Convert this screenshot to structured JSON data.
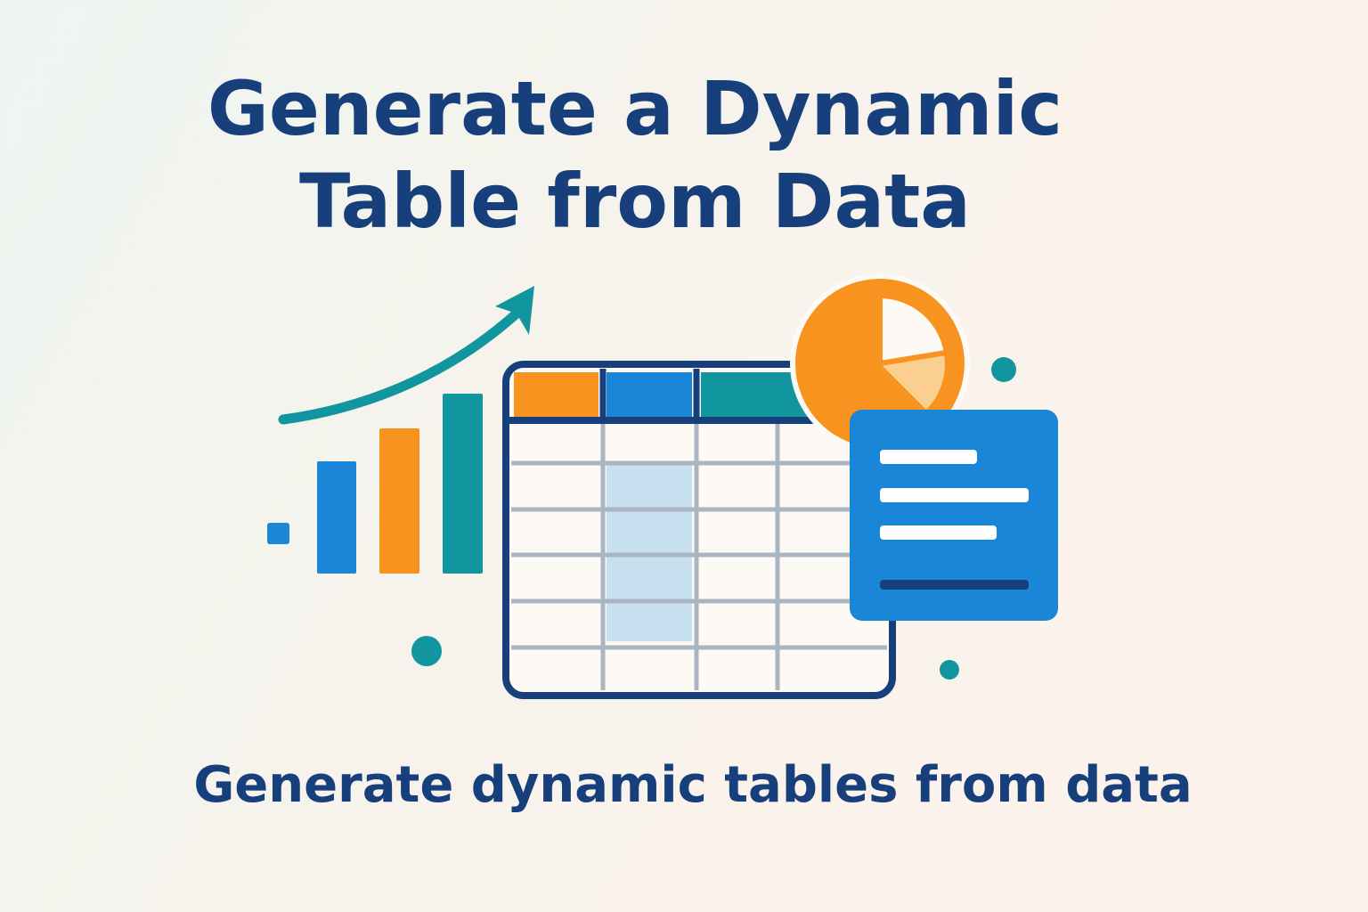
{
  "hero": {
    "title_line1": "Generate a Dynamic",
    "title_line2": "Table from Data",
    "subtitle": "Generate dynamic tables from data"
  },
  "illustration": {
    "icons": [
      "trend-arrow-icon",
      "bar-chart-icon",
      "spreadsheet-table-icon",
      "pie-chart-icon",
      "document-icon"
    ],
    "colors": {
      "navy": "#173f7c",
      "blue": "#1a86d8",
      "orange": "#f7931e",
      "teal": "#11959f",
      "light_orange": "#fbcf8f",
      "highlight": "#c6e0ef",
      "grid": "#aab4c2"
    }
  }
}
